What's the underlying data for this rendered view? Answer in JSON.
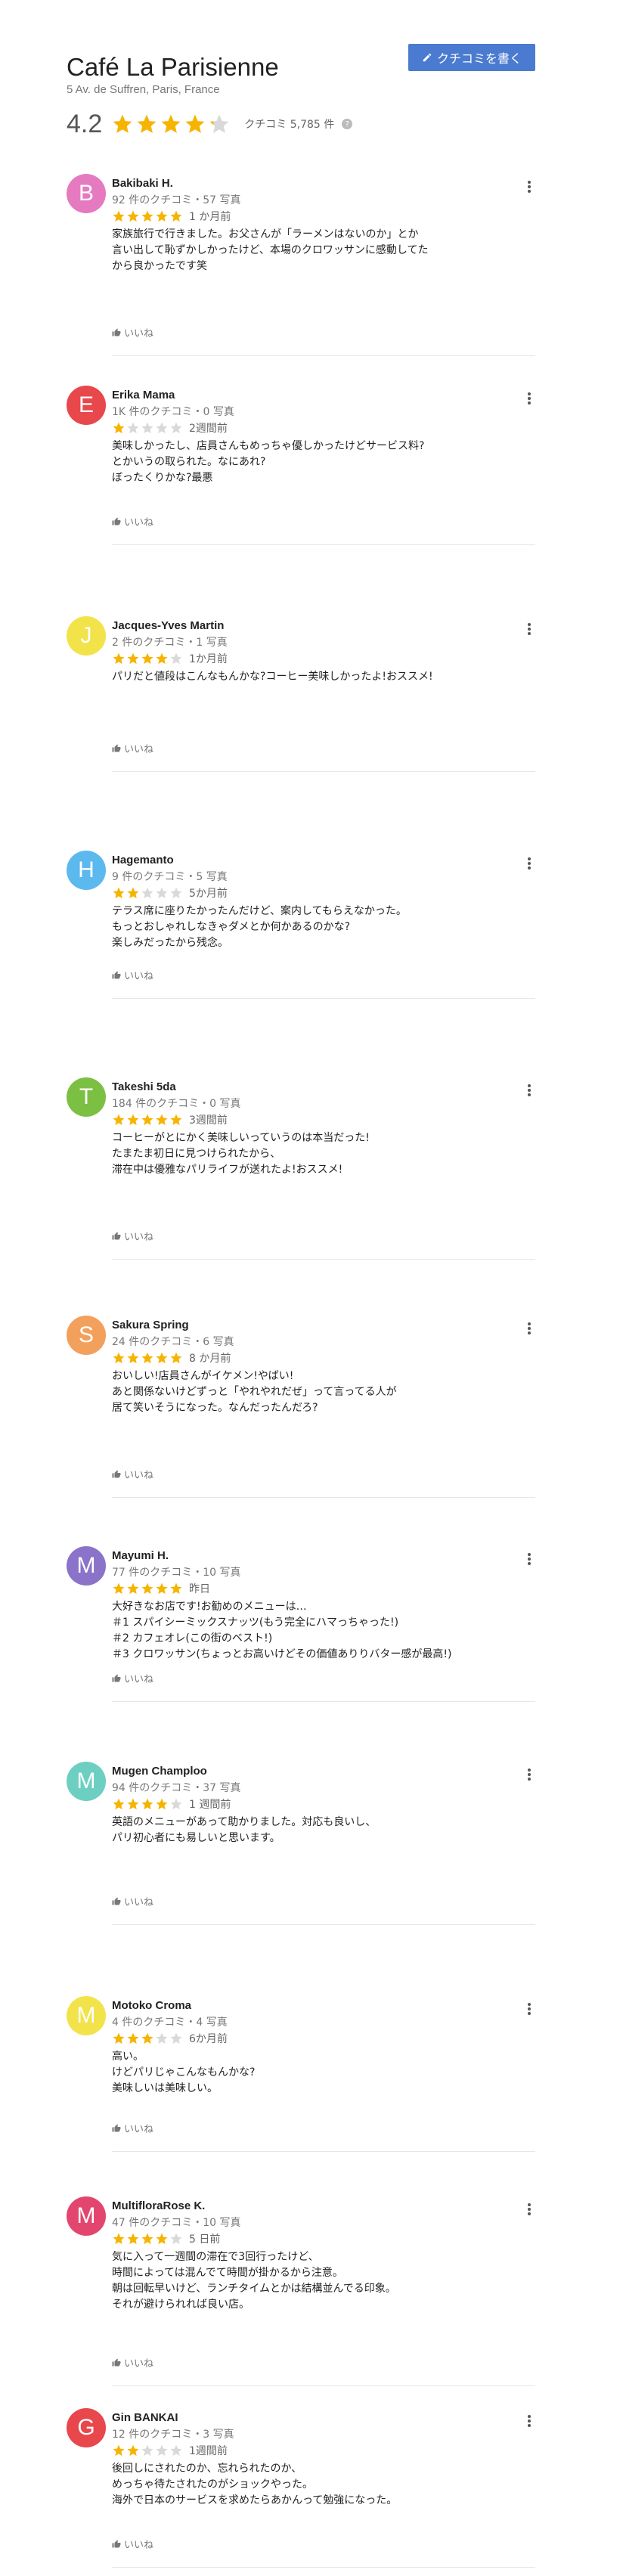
{
  "place": {
    "name": "Café La Parisienne",
    "address": "5 Av. de Suffren, Paris, France",
    "rating": "4.2",
    "rating_value": 4.2,
    "review_count": "クチコミ 5,785 件",
    "write_review": "クチコミを書く",
    "info_icon": "?"
  },
  "colors": {
    "star_filled": "#f6b400",
    "star_empty": "#d9d9d9",
    "write_button": "#4a7bd0"
  },
  "like_label": "いいね",
  "reviews": [
    {
      "initial": "B",
      "avatar_color": "#e57ac0",
      "name": "Bakibaki H.",
      "meta": "92 件のクチコミ・57 写真",
      "stars": 5,
      "time": "1 か月前",
      "text": "家族旅行で行きました。お父さんが「ラーメンはないのか」とか\n言い出して恥ずかしかったけど、本場のクロワッサンに感動してた\nから良かったです笑"
    },
    {
      "initial": "E",
      "avatar_color": "#e8474b",
      "name": "Erika Mama",
      "meta": "1K 件のクチコミ・0 写真",
      "stars": 1,
      "time": "2週間前",
      "text": "美味しかったし、店員さんもめっちゃ優しかったけどサービス料?\nとかいうの取られた。なにあれ?\nぼったくりかな?最悪"
    },
    {
      "initial": "J",
      "avatar_color": "#f2e34a",
      "name": "Jacques-Yves Martin",
      "meta": "2 件のクチコミ・1 写真",
      "stars": 4,
      "time": "1か月前",
      "text": "パリだと値段はこんなもんかな?コーヒー美味しかったよ!おススメ!"
    },
    {
      "initial": "H",
      "avatar_color": "#5bb9ee",
      "name": "Hagemanto",
      "meta": "9 件のクチコミ・5 写真",
      "stars": 2,
      "time": "5か月前",
      "text": "テラス席に座りたかったんだけど、案内してもらえなかった。\nもっとおしゃれしなきゃダメとか何かあるのかな?\n楽しみだったから残念。"
    },
    {
      "initial": "T",
      "avatar_color": "#7cc043",
      "name": "Takeshi 5da",
      "meta": "184 件のクチコミ・0 写真",
      "stars": 5,
      "time": "3週間前",
      "text": "コーヒーがとにかく美味しいっていうのは本当だった!\nたまたま初日に見つけられたから、\n滞在中は優雅なパリライフが送れたよ!おススメ!"
    },
    {
      "initial": "S",
      "avatar_color": "#f3a05c",
      "name": "Sakura Spring",
      "meta": "24 件のクチコミ・6 写真",
      "stars": 5,
      "time": "8 か月前",
      "text": "おいしい!店員さんがイケメン!やばい!\nあと関係ないけどずっと「やれやれだぜ」って言ってる人が\n居て笑いそうになった。なんだったんだろ?"
    },
    {
      "initial": "M",
      "avatar_color": "#8a73c9",
      "name": "Mayumi H.",
      "meta": "77 件のクチコミ・10 写真",
      "stars": 5,
      "time": "昨日",
      "text": "大好きなお店です!お勧めのメニューは…\n＃1 スパイシーミックスナッツ(もう完全にハマっちゃった!)\n＃2 カフェオレ(この街のベスト!)\n＃3 クロワッサン(ちょっとお高いけどその価値ありりバター感が最高!)"
    },
    {
      "initial": "M",
      "avatar_color": "#6ccfc2",
      "name": "Mugen Champloo",
      "meta": "94 件のクチコミ・37 写真",
      "stars": 4,
      "time": "1 週間前",
      "text": "英語のメニューがあって助かりました。対応も良いし、\nパリ初心者にも易しいと思います。"
    },
    {
      "initial": "M",
      "avatar_color": "#f2e34a",
      "name": "Motoko Croma",
      "meta": "4 件のクチコミ・4 写真",
      "stars": 3,
      "time": "6か月前",
      "text": "高い。\nけどパリじゃこんなもんかな?\n美味しいは美味しい。"
    },
    {
      "initial": "M",
      "avatar_color": "#e2466e",
      "name": "MultifloraRose K.",
      "meta": "47 件のクチコミ・10 写真",
      "stars": 4,
      "time": "5 日前",
      "text": "気に入って一週間の滞在で3回行ったけど、\n時間によっては混んでて時間が掛かるから注意。\n朝は回転早いけど、ランチタイムとかは結構並んでる印象。\nそれが避けられれば良い店。"
    },
    {
      "initial": "G",
      "avatar_color": "#e8474b",
      "name": "Gin BANKAI",
      "meta": "12 件のクチコミ・3 写真",
      "stars": 2,
      "time": "1週間前",
      "text": "後回しにされたのか、忘れられたのか、\nめっちゃ待たされたのがショックやった。\n海外で日本のサービスを求めたらあかんって勉強になった。"
    }
  ]
}
